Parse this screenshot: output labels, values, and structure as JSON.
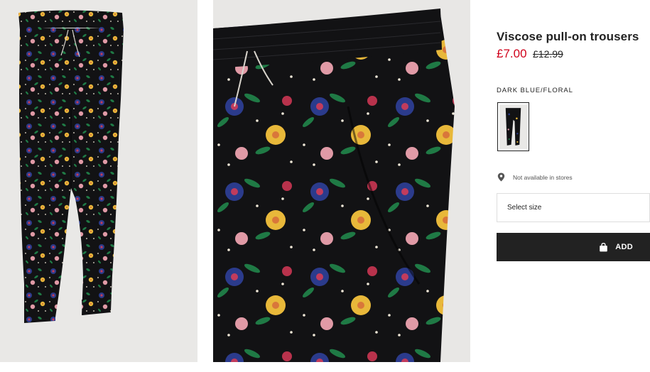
{
  "product": {
    "title": "Viscose pull-on trousers",
    "price_current": "£7.00",
    "price_original": "£12.99",
    "colour_name": "DARK BLUE/FLORAL",
    "availability": "Not available in stores",
    "size_placeholder": "Select size",
    "add_label": "ADD"
  },
  "icons": {
    "location": "map-pin-icon",
    "bag": "shopping-bag-icon"
  },
  "colors": {
    "sale_price": "#d0021b",
    "button_bg": "#222222",
    "button_text": "#ffffff",
    "fabric": "#121214",
    "image_bg": "#e9e8e6"
  }
}
